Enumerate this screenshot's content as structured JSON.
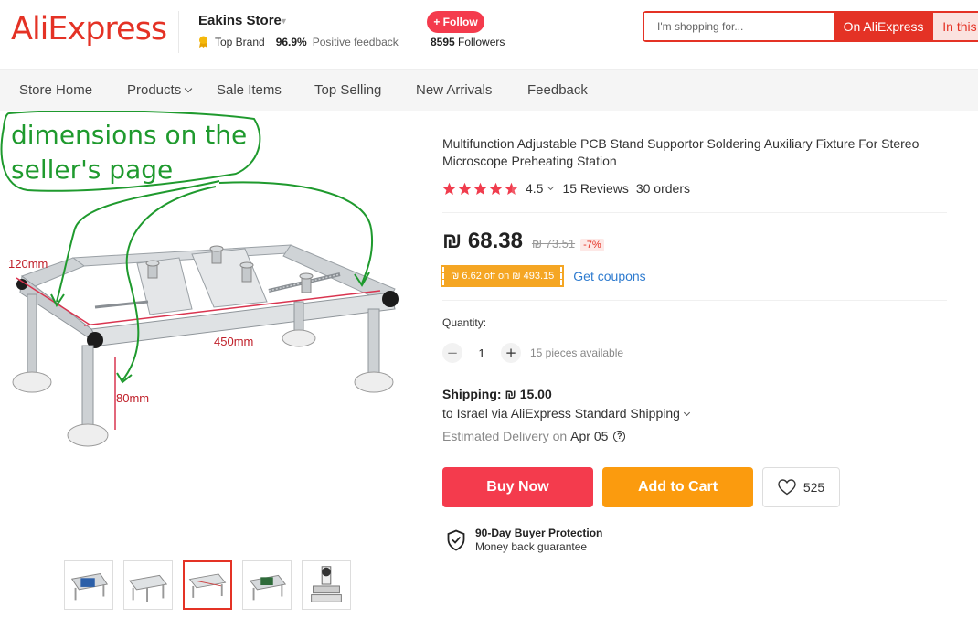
{
  "header": {
    "logo": "AliExpress",
    "store_name": "Eakins Store",
    "top_brand": "Top Brand",
    "positive_pct": "96.9%",
    "positive_label": "Positive feedback",
    "follow_label": "+ Follow",
    "followers_count": "8595",
    "followers_label": "Followers",
    "search_placeholder": "I'm shopping for...",
    "search_btn_ali": "On AliExpress",
    "search_btn_store": "In this store"
  },
  "nav": {
    "items": [
      "Store Home",
      "Products",
      "Sale Items",
      "Top Selling",
      "New Arrivals",
      "Feedback"
    ]
  },
  "image": {
    "annotation": "dimensions on the seller's page",
    "annotation_line1": "dimensions on the",
    "annotation_line2": "seller's page",
    "dim_width": "120mm",
    "dim_length": "450mm",
    "dim_height": "80mm"
  },
  "product": {
    "title": "Multifunction Adjustable PCB Stand Supportor Soldering Auxiliary Fixture For Stereo Microscope Preheating Station",
    "rating": "4.5",
    "reviews": "15 Reviews",
    "orders": "30 orders",
    "price": "₪ 68.38",
    "original_price": "₪ 73.51",
    "discount": "-7%",
    "coupon": "₪ 6.62 off on ₪ 493.15",
    "get_coupons": "Get coupons",
    "quantity_label": "Quantity:",
    "quantity": "1",
    "pieces_available": "15 pieces available",
    "shipping": "Shipping: ₪ 15.00",
    "ship_to": "to Israel via AliExpress Standard Shipping",
    "delivery_label": "Estimated Delivery on",
    "delivery_date": "Apr 05",
    "buy_now": "Buy Now",
    "add_to_cart": "Add to Cart",
    "wishlist_count": "525",
    "protection_title": "90-Day Buyer Protection",
    "protection_sub": "Money back guarantee"
  },
  "colors": {
    "brand_red": "#e43225",
    "buy_red": "#f43b4d",
    "cart_orange": "#fb9b0e",
    "coupon_orange": "#f5a623",
    "annotation_green": "#1f9a2e",
    "link_blue": "#2e7bcf"
  },
  "icons": [
    "medal-icon",
    "star-icon",
    "help-icon",
    "heart-icon",
    "shield-check-icon"
  ]
}
